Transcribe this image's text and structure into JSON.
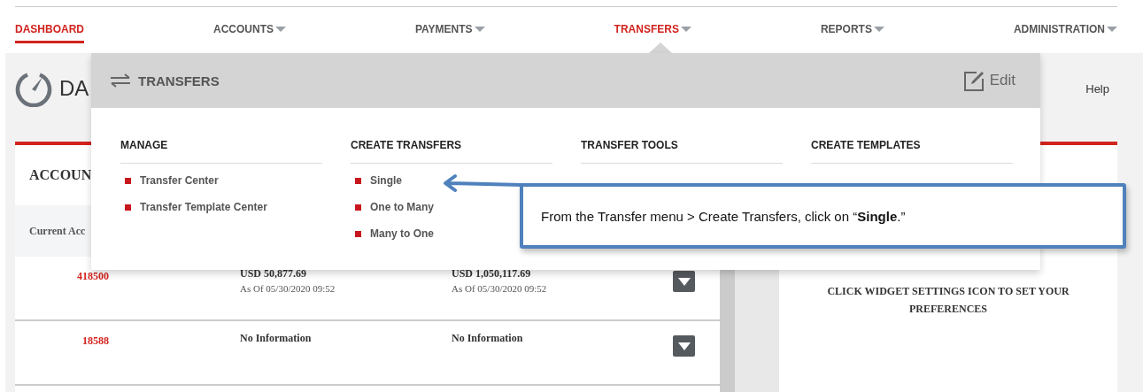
{
  "nav": [
    {
      "label": "DASHBOARD",
      "selected": true,
      "open": false,
      "dropdown": false
    },
    {
      "label": "ACCOUNTS",
      "selected": false,
      "open": false,
      "dropdown": true
    },
    {
      "label": "PAYMENTS",
      "selected": false,
      "open": false,
      "dropdown": true
    },
    {
      "label": "TRANSFERS",
      "selected": false,
      "open": true,
      "dropdown": true
    },
    {
      "label": "REPORTS",
      "selected": false,
      "open": false,
      "dropdown": true
    },
    {
      "label": "ADMINISTRATION",
      "selected": false,
      "open": false,
      "dropdown": true
    }
  ],
  "page": {
    "title": "DA",
    "help": "Help"
  },
  "accounts_widget": {
    "title": "ACCOUN",
    "header": "Current Acc",
    "rows": [
      {
        "account": "418500",
        "column_2": [
          "USD 50,877.69",
          "As Of 05/30/2020 09:52"
        ],
        "column_3": [
          "USD 1,050,117.69",
          "As Of 05/30/2020 09:52"
        ]
      },
      {
        "account": "18588",
        "column_2": [
          "No Information"
        ],
        "column_3": [
          "No Information"
        ]
      }
    ]
  },
  "settings_widget": {
    "message": "CLICK WIDGET SETTINGS ICON TO SET YOUR PREFERENCES"
  },
  "menu": {
    "title": "TRANSFERS",
    "edit": "Edit",
    "columns": [
      {
        "heading": "MANAGE",
        "items": [
          "Transfer Center",
          "Transfer Template Center"
        ]
      },
      {
        "heading": "CREATE TRANSFERS",
        "items": [
          "Single",
          "One to Many",
          "Many to One"
        ]
      },
      {
        "heading": "TRANSFER TOOLS"
      },
      {
        "heading": "CREATE TEMPLATES"
      }
    ]
  },
  "callout": {
    "text": "From the Transfer menu > Create Transfers, click on “**Single**.”"
  }
}
